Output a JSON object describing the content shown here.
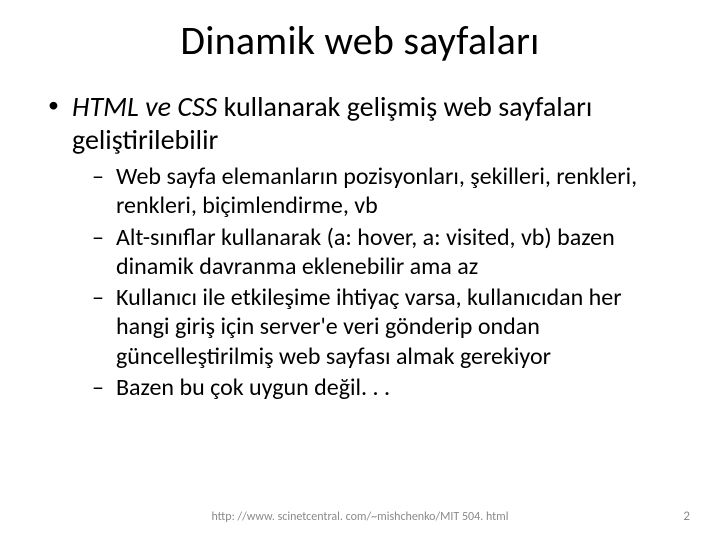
{
  "title": "Dinamik web sayfaları",
  "bullet1": {
    "emph": "HTML ve CSS",
    "rest": " kullanarak gelişmiş web sayfaları geliştirilebilir"
  },
  "sub": [
    "Web sayfa elemanların pozisyonları, şekilleri, renkleri, renkleri, biçimlendirme, vb",
    "Alt-sınıflar kullanarak (a: hover, a: visited, vb) bazen dinamik davranma eklenebilir ama az",
    "Kullanıcı ile etkileşime ihtiyaç varsa, kullanıcıdan her hangi giriş için server'e veri gönderip ondan güncelleştirilmiş web sayfası almak gerekiyor",
    "Bazen bu çok uygun değil. . ."
  ],
  "footer_url": "http: //www. scinetcentral. com/~mishchenko/MIT 504. html",
  "page_number": "2"
}
